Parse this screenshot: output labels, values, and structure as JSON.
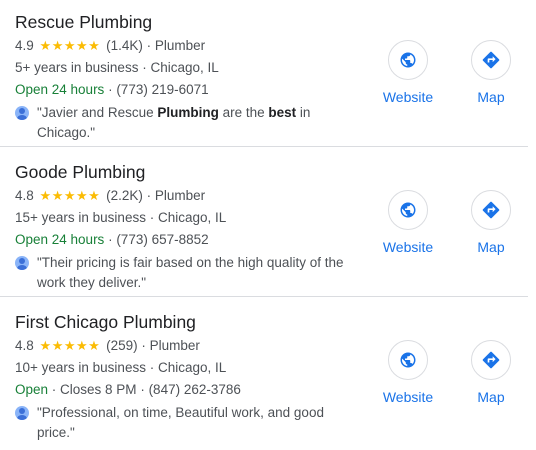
{
  "results": [
    {
      "name": "Rescue Plumbing",
      "rating": "4.9",
      "stars": "★★★★★",
      "reviews": "(1.4K)",
      "category": "Plumber",
      "years": "5+ years in business",
      "city": "Chicago, IL",
      "status": "Open 24 hours",
      "hours_extra": "",
      "phone": "(773) 219-6071",
      "review_parts": [
        "\"Javier and Rescue ",
        "Plumbing",
        " are the ",
        "best",
        " in Chicago.\""
      ],
      "website_label": "Website",
      "map_label": "Map"
    },
    {
      "name": "Goode Plumbing",
      "rating": "4.8",
      "stars": "★★★★★",
      "reviews": "(2.2K)",
      "category": "Plumber",
      "years": "15+ years in business",
      "city": "Chicago, IL",
      "status": "Open 24 hours",
      "hours_extra": "",
      "phone": "(773) 657-8852",
      "review_parts": [
        "\"Their pricing is fair based on the high quality of the work they deliver.\""
      ],
      "website_label": "Website",
      "map_label": "Map"
    },
    {
      "name": "First Chicago Plumbing",
      "rating": "4.8",
      "stars": "★★★★★",
      "reviews": "(259)",
      "category": "Plumber",
      "years": "10+ years in business",
      "city": "Chicago, IL",
      "status": "Open",
      "hours_extra": "Closes 8 PM",
      "phone": "(847) 262-3786",
      "review_parts": [
        "\"Professional, on time, Beautiful work, and good price.\""
      ],
      "website_label": "Website",
      "map_label": "Map"
    }
  ],
  "colors": {
    "link": "#1a73e8",
    "open": "#188038",
    "star": "#fbbc04",
    "divider": "#dadce0"
  },
  "icons": {
    "website": "globe-icon",
    "map": "directions-icon",
    "avatar": "user-avatar-icon"
  }
}
